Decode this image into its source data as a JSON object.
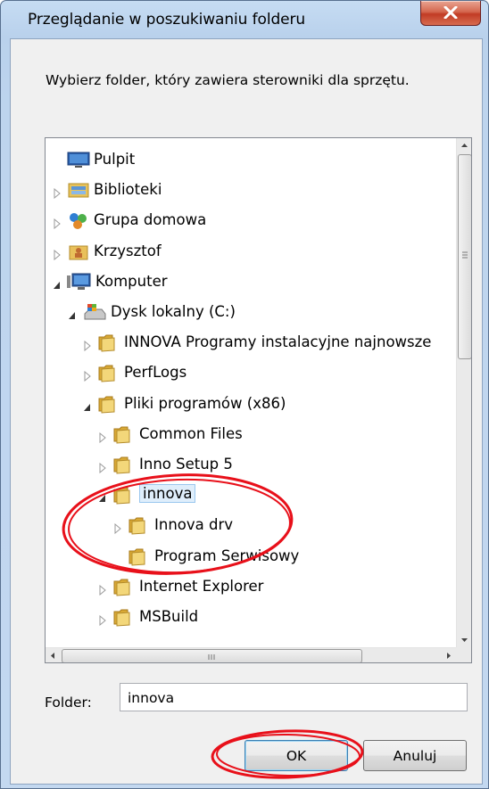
{
  "window": {
    "title": "Przeglądanie w poszukiwaniu folderu",
    "close_glyph": "x"
  },
  "prompt": "Wybierz folder, który zawiera sterowniki dla sprzętu.",
  "tree": {
    "items": [
      {
        "label": "Pulpit",
        "icon": "desktop-icon",
        "arrow": "none"
      },
      {
        "label": "Biblioteki",
        "icon": "libraries-icon",
        "arrow": "collapsed"
      },
      {
        "label": "Grupa domowa",
        "icon": "homegroup-icon",
        "arrow": "collapsed"
      },
      {
        "label": "Krzysztof",
        "icon": "user-folder-icon",
        "arrow": "collapsed"
      },
      {
        "label": "Komputer",
        "icon": "computer-icon",
        "arrow": "expanded"
      },
      {
        "label": "Dysk lokalny (C:)",
        "icon": "drive-icon",
        "arrow": "expanded"
      },
      {
        "label": "INNOVA Programy instalacyjne najnowsze",
        "icon": "folder-icon",
        "arrow": "collapsed"
      },
      {
        "label": "PerfLogs",
        "icon": "folder-icon",
        "arrow": "collapsed"
      },
      {
        "label": "Pliki programów (x86)",
        "icon": "folder-icon",
        "arrow": "expanded"
      },
      {
        "label": "Common Files",
        "icon": "folder-icon",
        "arrow": "collapsed"
      },
      {
        "label": "Inno Setup 5",
        "icon": "folder-icon",
        "arrow": "collapsed"
      },
      {
        "label": "innova",
        "icon": "folder-icon",
        "arrow": "expanded",
        "selected": true
      },
      {
        "label": "Innova drv",
        "icon": "folder-icon",
        "arrow": "collapsed"
      },
      {
        "label": "Program Serwisowy",
        "icon": "folder-icon",
        "arrow": "none"
      },
      {
        "label": "Internet Explorer",
        "icon": "folder-icon",
        "arrow": "collapsed"
      },
      {
        "label": "MSBuild",
        "icon": "folder-icon",
        "arrow": "collapsed"
      }
    ]
  },
  "folder": {
    "label": "Folder:",
    "value": "innova"
  },
  "buttons": {
    "ok": "OK",
    "cancel": "Anuluj"
  },
  "colors": {
    "annotation": "#e8101a",
    "title_gradient": "#bdd4ee",
    "close_button": "#c13c25"
  }
}
